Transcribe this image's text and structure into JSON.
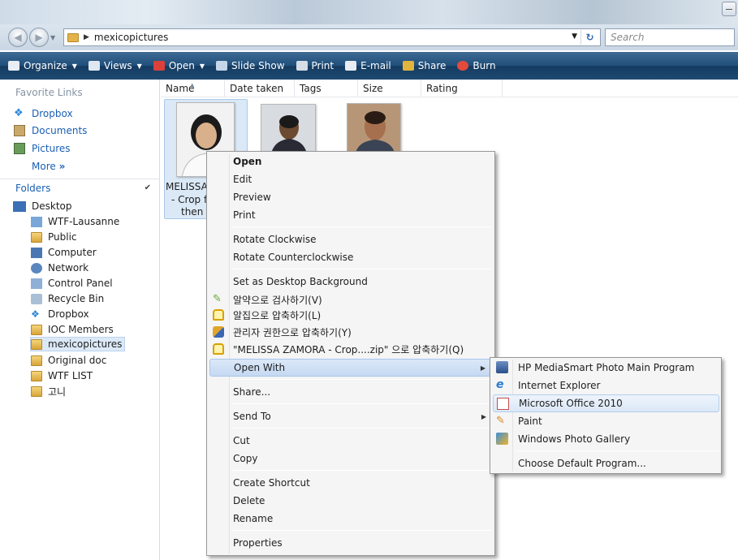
{
  "address": {
    "path": "mexicopictures",
    "search_placeholder": "Search"
  },
  "toolbar": {
    "items": [
      "Organize",
      "Views",
      "Open",
      "Slide Show",
      "Print",
      "E-mail",
      "Share",
      "Burn"
    ]
  },
  "nav": {
    "favorites_header": "Favorite Links",
    "favorites": [
      "Dropbox",
      "Documents",
      "Pictures"
    ],
    "more": "More",
    "folders_header": "Folders",
    "tree": [
      "Desktop",
      "WTF-Lausanne",
      "Public",
      "Computer",
      "Network",
      "Control Panel",
      "Recycle Bin",
      "Dropbox",
      "IOC Members",
      "mexicopictures",
      "Original doc",
      "WTF LIST",
      "고니"
    ]
  },
  "columns": [
    "Name",
    "Date taken",
    "Tags",
    "Size",
    "Rating"
  ],
  "files": {
    "selected_label_lines": [
      "MELISSA",
      "- Crop f",
      "then"
    ]
  },
  "context_menu": {
    "items": [
      "Open",
      "Edit",
      "Preview",
      "Print",
      "Rotate Clockwise",
      "Rotate Counterclockwise",
      "Set as Desktop Background",
      "알약으로 검사하기(V)",
      "알집으로 압축하기(L)",
      "관리자 권한으로 압축하기(Y)",
      "\"MELISSA ZAMORA - Crop....zip\" 으로 압축하기(Q)",
      "Open With",
      "Share...",
      "Send To",
      "Cut",
      "Copy",
      "Create Shortcut",
      "Delete",
      "Rename",
      "Properties"
    ]
  },
  "open_with_submenu": {
    "items": [
      "HP MediaSmart Photo Main Program",
      "Internet Explorer",
      "Microsoft Office 2010",
      "Paint",
      "Windows Photo Gallery",
      "Choose Default Program..."
    ]
  }
}
